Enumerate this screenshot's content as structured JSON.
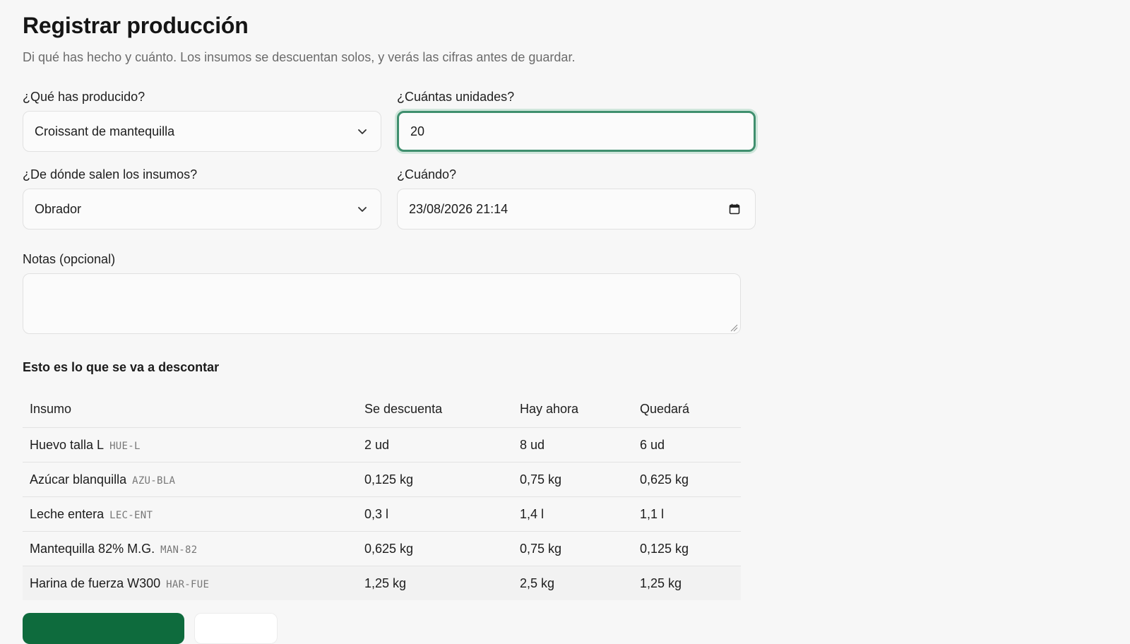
{
  "page": {
    "title": "Registrar producción",
    "subtitle": "Di qué has hecho y cuánto. Los insumos se descuentan solos, y verás las cifras antes de guardar."
  },
  "form": {
    "product": {
      "label": "¿Qué has producido?",
      "value": "Croissant de mantequilla"
    },
    "quantity": {
      "label": "¿Cuántas unidades?",
      "value": "20"
    },
    "source": {
      "label": "¿De dónde salen los insumos?",
      "value": "Obrador"
    },
    "when": {
      "label": "¿Cuándo?",
      "value": "23/08/2026 21:14"
    },
    "notes": {
      "label": "Notas (opcional)",
      "value": ""
    }
  },
  "deduction": {
    "title": "Esto es lo que se va a descontar",
    "headers": [
      "Insumo",
      "Se descuenta",
      "Hay ahora",
      "Quedará"
    ],
    "rows": [
      {
        "name": "Huevo talla L",
        "code": "HUE-L",
        "deduct": "2 ud",
        "current": "8 ud",
        "remaining": "6 ud"
      },
      {
        "name": "Azúcar blanquilla",
        "code": "AZU-BLA",
        "deduct": "0,125 kg",
        "current": "0,75 kg",
        "remaining": "0,625 kg"
      },
      {
        "name": "Leche entera",
        "code": "LEC-ENT",
        "deduct": "0,3 l",
        "current": "1,4 l",
        "remaining": "1,1 l"
      },
      {
        "name": "Mantequilla 82% M.G.",
        "code": "MAN-82",
        "deduct": "0,625 kg",
        "current": "0,75 kg",
        "remaining": "0,125 kg"
      },
      {
        "name": "Harina de fuerza W300",
        "code": "HAR-FUE",
        "deduct": "1,25 kg",
        "current": "2,5 kg",
        "remaining": "1,25 kg"
      }
    ]
  },
  "icons": {
    "select": "chevron-down-icon",
    "date": "calendar-icon",
    "resize": "resize-handle-icon"
  },
  "colors": {
    "primary_button": "#0e6b3d",
    "focus_ring": "#3f8f6e"
  }
}
